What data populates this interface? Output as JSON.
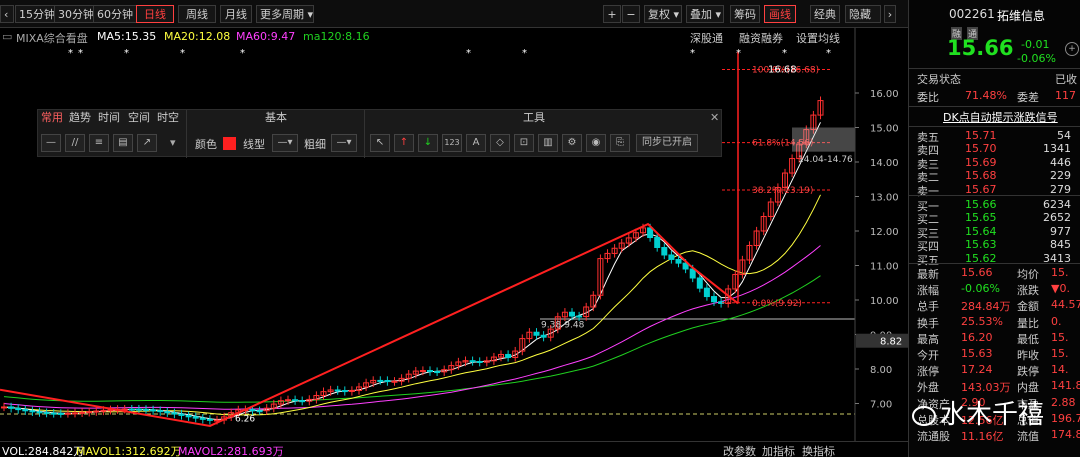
{
  "toolbar": {
    "periods": [
      "15分钟",
      "30分钟",
      "60分钟",
      "日线",
      "周线",
      "月线",
      "更多周期"
    ],
    "active_period": "日线",
    "right_buttons": [
      "复权",
      "叠加",
      "筹码",
      "画线",
      "经典",
      "隐藏"
    ],
    "active_right": "画线"
  },
  "ma_line": {
    "title": "MIXA综合看盘",
    "ma5": "MA5:15.35",
    "ma20": "MA20:12.08",
    "ma60": "MA60:9.47",
    "ma120": "ma120:8.16",
    "links": [
      "深股通",
      "融资融券",
      "设置均线"
    ]
  },
  "tool_panel": {
    "tabs": [
      "常用",
      "趋势",
      "时间",
      "空间",
      "时空"
    ],
    "active_tab": "常用",
    "section_basic": "基本",
    "section_tools": "工具",
    "color_label": "颜色",
    "linetype_label": "线型",
    "thickness_label": "粗细",
    "sync_label": "同步已开启",
    "close_icon": "✕"
  },
  "chart_data": {
    "type": "candlestick",
    "y_axis_labels": [
      "16.00",
      "15.00",
      "14.00",
      "13.00",
      "12.00",
      "11.00",
      "10.00",
      "9.00",
      "8.00",
      "7.00"
    ],
    "current_price_tag": "8.82",
    "annotations": {
      "high_label": "16.68",
      "zone_label": "14.04-14.76",
      "range_label": "9.38-9.48",
      "fib_100": "100.0%(16.68)",
      "fib_618": "61.8%(14.56)",
      "fib_382": "38.2%(13.19)",
      "fib_0": "0.0%(9.92)",
      "low_label": "6.26"
    },
    "colors": {
      "up": "#ff3030",
      "down": "#00d0d0",
      "ma5": "#ffffff",
      "ma20": "#ffff40",
      "ma60": "#ff40ff",
      "ma120": "#20d020"
    }
  },
  "bottom": {
    "vol": "VOL:284.842万",
    "mavol1": "MAVOL1:312.692万",
    "mavol2": "MAVOL2:281.693万",
    "links": [
      "改参数",
      "加指标",
      "换指标"
    ]
  },
  "quote": {
    "code": "002261",
    "name": "拓维信息",
    "tags": [
      "融",
      "通"
    ],
    "price": "15.66",
    "change": "-0.01",
    "change_pct": "-0.06%",
    "status_label": "交易状态",
    "status_value": "已收",
    "weibi_label": "委比",
    "weibi_value": "71.48%",
    "weicha_label": "委差",
    "weicha_value": "117",
    "signal": "DK点自动提示涨跌信号",
    "sells": [
      {
        "label": "卖五",
        "price": "15.71",
        "vol": "54"
      },
      {
        "label": "卖四",
        "price": "15.70",
        "vol": "1341"
      },
      {
        "label": "卖三",
        "price": "15.69",
        "vol": "446"
      },
      {
        "label": "卖二",
        "price": "15.68",
        "vol": "229"
      },
      {
        "label": "卖一",
        "price": "15.67",
        "vol": "279"
      }
    ],
    "buys": [
      {
        "label": "买一",
        "price": "15.66",
        "vol": "6234"
      },
      {
        "label": "买二",
        "price": "15.65",
        "vol": "2652"
      },
      {
        "label": "买三",
        "price": "15.64",
        "vol": "977"
      },
      {
        "label": "买四",
        "price": "15.63",
        "vol": "845"
      },
      {
        "label": "买五",
        "price": "15.62",
        "vol": "3413"
      }
    ],
    "stats": [
      {
        "l1": "最新",
        "v1": "15.66",
        "l2": "均价",
        "v2": "15."
      },
      {
        "l1": "涨幅",
        "v1": "-0.06%",
        "l2": "涨跌",
        "v2": "▼0."
      },
      {
        "l1": "总手",
        "v1": "284.84万",
        "l2": "金额",
        "v2": "44.57"
      },
      {
        "l1": "换手",
        "v1": "25.53%",
        "l2": "量比",
        "v2": "0."
      },
      {
        "l1": "最高",
        "v1": "16.20",
        "l2": "最低",
        "v2": "15."
      },
      {
        "l1": "今开",
        "v1": "15.63",
        "l2": "昨收",
        "v2": "15."
      },
      {
        "l1": "涨停",
        "v1": "17.24",
        "l2": "跌停",
        "v2": "14."
      },
      {
        "l1": "外盘",
        "v1": "143.03万",
        "l2": "内盘",
        "v2": "141.81"
      },
      {
        "l1": "净资产",
        "v1": "2.90",
        "l2": "市盈",
        "v2": "2.88"
      },
      {
        "l1": "总股本",
        "v1": "12.56亿",
        "l2": "总值",
        "v2": "196.7"
      },
      {
        "l1": "流通股",
        "v1": "11.16亿",
        "l2": "流值",
        "v2": "174.8"
      }
    ],
    "extra_value": "143."
  },
  "watermark": "水木千禧"
}
